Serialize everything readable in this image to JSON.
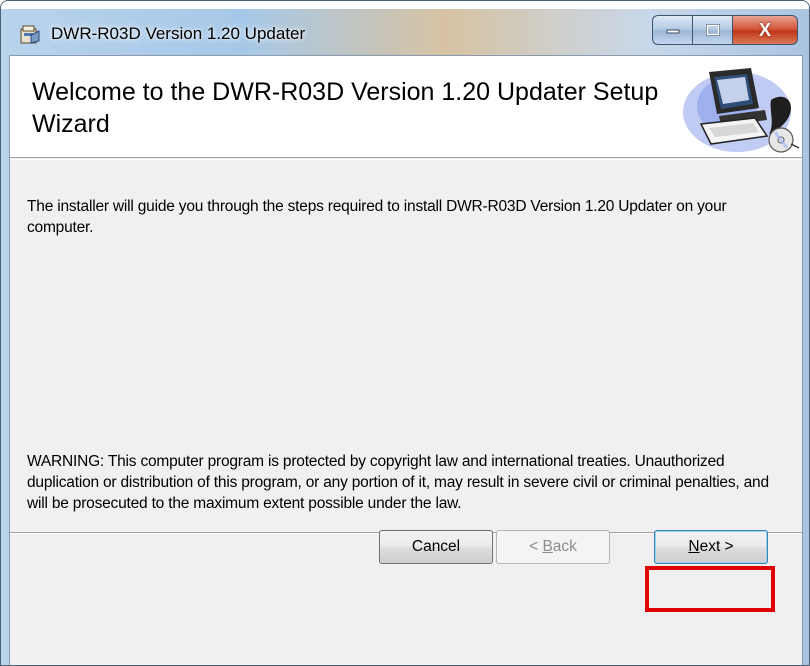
{
  "window": {
    "title": "DWR-R03D Version 1.20 Updater",
    "close_glyph": "X",
    "minimize_glyph": "",
    "maximize_glyph": ""
  },
  "banner": {
    "title": "Welcome to the DWR-R03D Version 1.20 Updater Setup Wizard"
  },
  "body": {
    "intro": "The installer will guide you through the steps required to install DWR-R03D Version 1.20 Updater on your computer.",
    "warning": "WARNING: This computer program is protected by copyright law and international treaties. Unauthorized duplication or distribution of this program, or any portion of it, may result in severe civil or criminal penalties, and will be prosecuted to the maximum extent possible under the law."
  },
  "buttons": {
    "cancel": "Cancel",
    "back_prefix": "< ",
    "back_mnemonic": "B",
    "back_rest": "ack",
    "next_mnemonic": "N",
    "next_rest": "ext >"
  },
  "colors": {
    "highlight": "#e00000",
    "client_background": "#f0f0f0",
    "banner_background": "#ffffff"
  },
  "icons": [
    "installer-app-icon",
    "computer-cd-illustration",
    "minimize-icon",
    "maximize-icon",
    "close-icon"
  ]
}
